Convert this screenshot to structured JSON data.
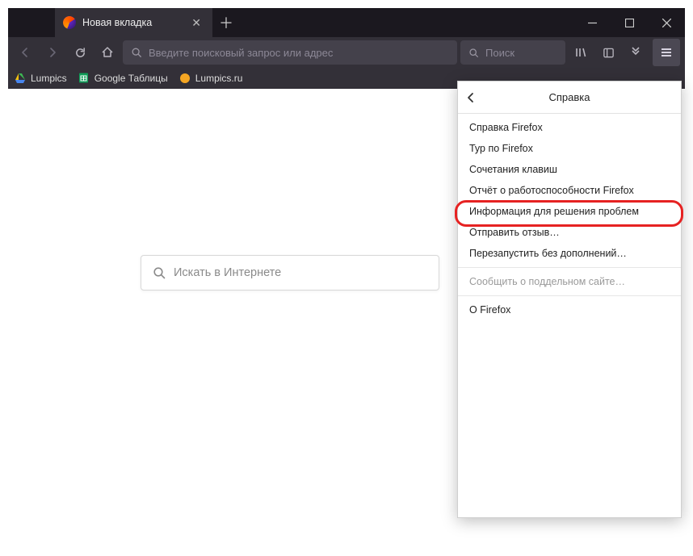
{
  "tab": {
    "title": "Новая вкладка"
  },
  "urlbar": {
    "placeholder": "Введите поисковый запрос или адрес"
  },
  "searchbar": {
    "placeholder": "Поиск"
  },
  "bookmarks": {
    "items": [
      {
        "label": "Lumpics"
      },
      {
        "label": "Google Таблицы"
      },
      {
        "label": "Lumpics.ru"
      }
    ]
  },
  "content": {
    "search_placeholder": "Искать в Интернете"
  },
  "panel": {
    "title": "Справка",
    "items": {
      "firefox_help": "Справка Firefox",
      "tour": "Тур по Firefox",
      "shortcuts": "Сочетания клавиш",
      "healthreport": "Отчёт о работоспособности Firefox",
      "troubleshoot": "Информация для решения проблем",
      "feedback": "Отправить отзыв…",
      "restart_noaddons": "Перезапустить без дополнений…",
      "report_fake": "Сообщить о поддельном сайте…",
      "about": "О Firefox"
    }
  }
}
